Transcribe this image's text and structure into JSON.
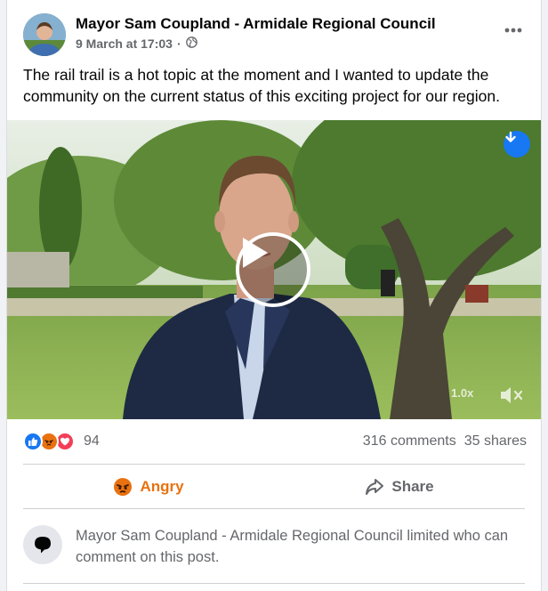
{
  "post": {
    "author": "Mayor Sam Coupland - Armidale Regional Council",
    "date": "9 March at 17:03",
    "separator": "·",
    "privacy_icon": "globe-icon",
    "more_icon": "ellipsis-icon",
    "text": "The rail trail is a hot topic at the moment and I wanted to update the community on the current status of this exciting project for our region."
  },
  "video": {
    "playback_speed": "1.0x",
    "play_icon": "play-icon",
    "download_icon": "download-icon",
    "mute_icon": "speaker-muted-icon"
  },
  "stats": {
    "reaction_icons": [
      "like-icon",
      "angry-icon",
      "love-icon"
    ],
    "reaction_count": "94",
    "comments": "316 comments",
    "shares": "35 shares"
  },
  "actions": {
    "reaction_label": "Angry",
    "share_label": "Share"
  },
  "notice": {
    "text": "Mayor Sam Coupland - Armidale Regional Council limited who can comment on this post."
  },
  "colors": {
    "accent": "#1877f2",
    "angry": "#e9710f",
    "love": "#f33e58",
    "secondary_text": "#65676b"
  }
}
